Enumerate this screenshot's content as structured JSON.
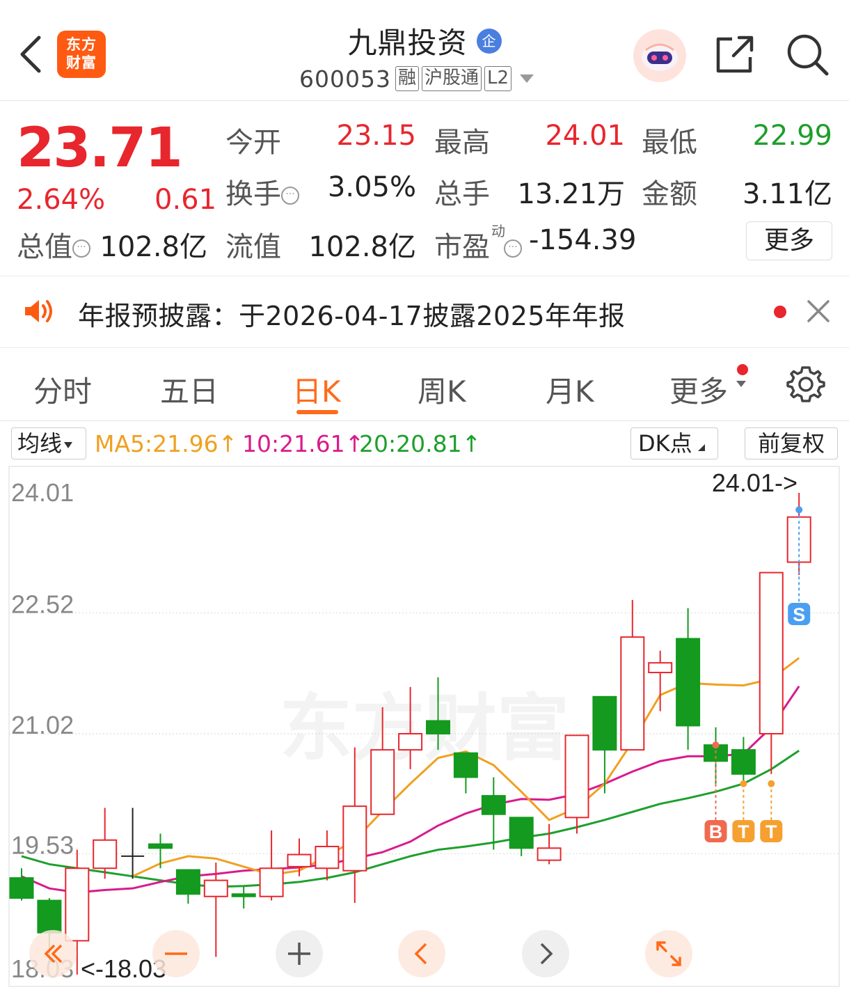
{
  "header": {
    "logo_text": "东方财富",
    "title": "九鼎投资",
    "title_badge": "企",
    "code": "600053",
    "tags": [
      "融",
      "沪股通",
      "L2"
    ]
  },
  "quote": {
    "price": "23.71",
    "change_pct": "2.64%",
    "change": "0.61",
    "open_label": "今开",
    "open": "23.15",
    "high_label": "最高",
    "high": "24.01",
    "low_label": "最低",
    "low": "22.99",
    "turnover_label": "换手",
    "turnover": "3.05%",
    "volume_label": "总手",
    "volume": "13.21万",
    "amount_label": "金额",
    "amount": "3.11亿",
    "mktcap_label": "总值",
    "mktcap": "102.8亿",
    "float_label": "流值",
    "float_cap": "102.8亿",
    "pe_label": "市盈",
    "pe_sup": "动",
    "pe": "-154.39",
    "more_label": "更多"
  },
  "notice": {
    "text": "年报预披露：于2026-04-17披露2025年年报"
  },
  "tabs": [
    "分时",
    "五日",
    "日K",
    "周K",
    "月K",
    "更多"
  ],
  "active_tab": "日K",
  "ma_bar": {
    "select_label": "均线",
    "ma5": "MA5:21.96↑",
    "ma10": "10:21.61↑",
    "ma20": "20:20.81↑",
    "dk_label": "DK点",
    "adjust_label": "前复权",
    "colors": {
      "ma5": "#f0a020",
      "ma10": "#d81b8c",
      "ma20": "#1e9f2c",
      "up": "#e8262d",
      "down": "#139a1f"
    }
  },
  "chart_data": {
    "type": "candlestick",
    "y_ticks": [
      "24.01",
      "22.52",
      "21.02",
      "19.53",
      "18.03"
    ],
    "ylim": [
      18.03,
      24.01
    ],
    "high_marker": "24.01->",
    "low_marker": "<-18.03",
    "watermark": "东方财富",
    "candles": [
      {
        "o": 19.23,
        "c": 18.98,
        "h": 19.35,
        "l": 18.95
      },
      {
        "o": 18.95,
        "c": 18.55,
        "h": 18.98,
        "l": 18.18
      },
      {
        "o": 18.45,
        "c": 19.35,
        "h": 19.58,
        "l": 18.03
      },
      {
        "o": 19.35,
        "c": 19.7,
        "h": 20.1,
        "l": 19.22
      },
      {
        "o": 19.5,
        "c": 19.5,
        "h": 20.1,
        "l": 19.22
      },
      {
        "o": 19.65,
        "c": 19.6,
        "h": 19.78,
        "l": 19.35
      },
      {
        "o": 19.33,
        "c": 19.03,
        "h": 19.33,
        "l": 18.91
      },
      {
        "o": 19.0,
        "c": 19.2,
        "h": 19.42,
        "l": 18.25
      },
      {
        "o": 19.03,
        "c": 19.0,
        "h": 19.12,
        "l": 18.85
      },
      {
        "o": 19.0,
        "c": 19.35,
        "h": 19.82,
        "l": 18.95
      },
      {
        "o": 19.37,
        "c": 19.52,
        "h": 19.72,
        "l": 19.25
      },
      {
        "o": 19.35,
        "c": 19.62,
        "h": 19.82,
        "l": 19.2
      },
      {
        "o": 19.32,
        "c": 20.12,
        "h": 20.85,
        "l": 18.92
      },
      {
        "o": 20.02,
        "c": 20.82,
        "h": 21.35,
        "l": 20.02
      },
      {
        "o": 20.82,
        "c": 21.02,
        "h": 21.6,
        "l": 20.58
      },
      {
        "o": 21.18,
        "c": 21.02,
        "h": 21.72,
        "l": 20.82
      },
      {
        "o": 20.78,
        "c": 20.48,
        "h": 20.78,
        "l": 20.28
      },
      {
        "o": 20.25,
        "c": 20.02,
        "h": 20.48,
        "l": 19.58
      },
      {
        "o": 19.98,
        "c": 19.6,
        "h": 19.98,
        "l": 19.5
      },
      {
        "o": 19.45,
        "c": 19.6,
        "h": 19.9,
        "l": 19.4
      },
      {
        "o": 19.98,
        "c": 21.0,
        "h": 21.0,
        "l": 19.78
      },
      {
        "o": 21.48,
        "c": 20.82,
        "h": 21.48,
        "l": 20.28
      },
      {
        "o": 20.82,
        "c": 22.22,
        "h": 22.68,
        "l": 20.82
      },
      {
        "o": 21.78,
        "c": 21.9,
        "h": 22.05,
        "l": 21.3
      },
      {
        "o": 22.2,
        "c": 21.12,
        "h": 22.58,
        "l": 20.82
      },
      {
        "o": 20.88,
        "c": 20.68,
        "h": 21.1,
        "l": 20.4
      },
      {
        "o": 20.82,
        "c": 20.52,
        "h": 20.98,
        "l": 20.4
      },
      {
        "o": 21.02,
        "c": 23.02,
        "h": 23.02,
        "l": 20.52
      },
      {
        "o": 23.15,
        "c": 23.71,
        "h": 24.01,
        "l": 22.99
      }
    ],
    "ma5": [
      null,
      null,
      null,
      null,
      19.25,
      19.41,
      19.5,
      19.47,
      19.37,
      19.27,
      19.32,
      19.5,
      19.7,
      20.06,
      20.4,
      20.72,
      20.8,
      20.63,
      20.3,
      19.95,
      20.1,
      20.4,
      20.92,
      21.5,
      21.65,
      21.63,
      21.62,
      21.7,
      21.96
    ],
    "ma10": [
      19.25,
      19.1,
      19.05,
      19.08,
      19.1,
      19.18,
      19.25,
      19.28,
      19.32,
      19.34,
      19.36,
      19.4,
      19.47,
      19.55,
      19.68,
      19.88,
      20.03,
      20.14,
      20.21,
      20.2,
      20.27,
      20.4,
      20.55,
      20.68,
      20.74,
      20.74,
      20.77,
      21.1,
      21.61
    ],
    "ma20": [
      19.5,
      19.4,
      19.35,
      19.3,
      19.25,
      19.2,
      19.15,
      19.12,
      19.13,
      19.15,
      19.18,
      19.23,
      19.3,
      19.4,
      19.5,
      19.58,
      19.62,
      19.67,
      19.73,
      19.78,
      19.86,
      19.95,
      20.05,
      20.15,
      20.22,
      20.3,
      20.4,
      20.58,
      20.81
    ],
    "signals": [
      {
        "index": 25,
        "label": "B",
        "color": "#f06a50",
        "price": 20.88
      },
      {
        "index": 26,
        "label": "T",
        "color": "#f5a030",
        "price": 20.4
      },
      {
        "index": 27,
        "label": "T",
        "color": "#f5a030",
        "price": 20.4
      },
      {
        "index": 28,
        "label": "S",
        "color": "#4a9ff0",
        "price": 23.8
      }
    ]
  },
  "controls": [
    "rewind",
    "zoom-out",
    "zoom-in",
    "prev",
    "next",
    "fullscreen"
  ]
}
